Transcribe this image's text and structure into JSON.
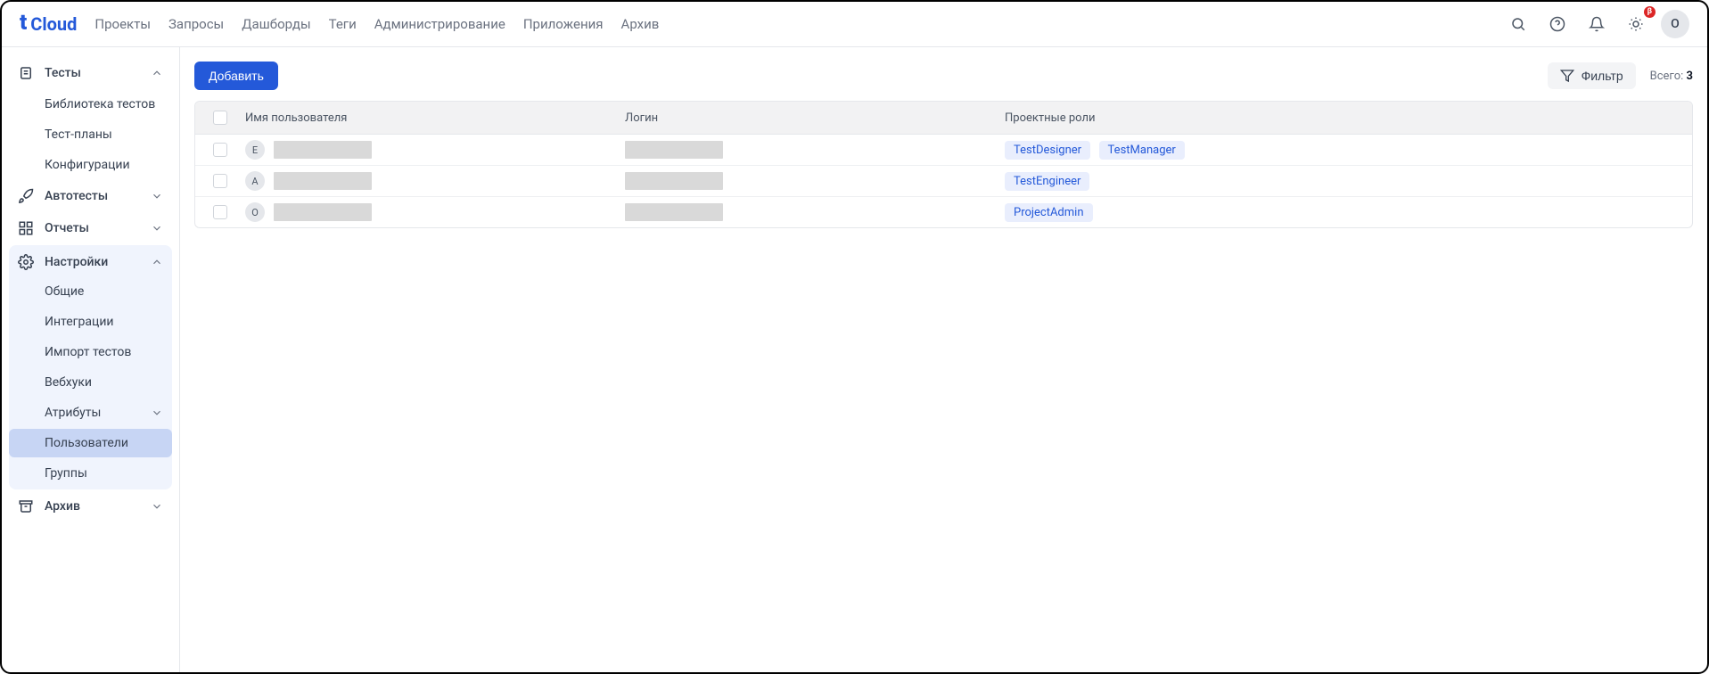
{
  "logo": {
    "text": "Cloud"
  },
  "nav": {
    "items": [
      "Проекты",
      "Запросы",
      "Дашборды",
      "Теги",
      "Администрирование",
      "Приложения",
      "Архив"
    ]
  },
  "header": {
    "beta": "β",
    "avatar": "O"
  },
  "sidebar": {
    "tests": {
      "label": "Тесты",
      "items": [
        "Библиотека тестов",
        "Тест-планы",
        "Конфигурации"
      ]
    },
    "autotests": {
      "label": "Автотесты"
    },
    "reports": {
      "label": "Отчеты"
    },
    "settings": {
      "label": "Настройки",
      "items": [
        "Общие",
        "Интеграции",
        "Импорт тестов",
        "Вебхуки",
        "Атрибуты",
        "Пользователи",
        "Группы"
      ]
    },
    "archive": {
      "label": "Архив"
    }
  },
  "toolbar": {
    "add": "Добавить",
    "filter": "Фильтр",
    "total_label": "Всего: ",
    "total_count": "3"
  },
  "table": {
    "headers": {
      "user": "Имя пользователя",
      "login": "Логин",
      "roles": "Проектные роли"
    },
    "rows": [
      {
        "avatar": "E",
        "roles": [
          "TestDesigner",
          "TestManager"
        ]
      },
      {
        "avatar": "A",
        "roles": [
          "TestEngineer"
        ]
      },
      {
        "avatar": "O",
        "roles": [
          "ProjectAdmin"
        ]
      }
    ]
  }
}
